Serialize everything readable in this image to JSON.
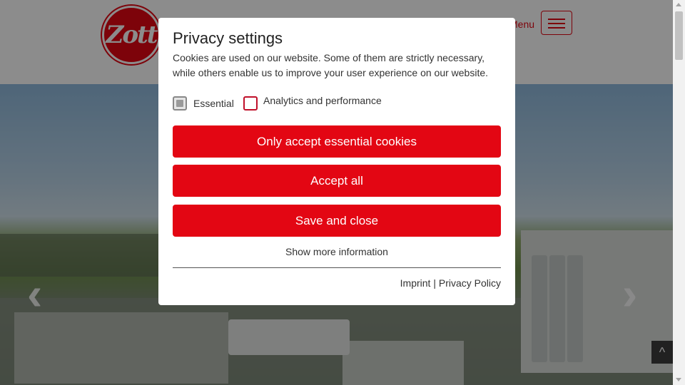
{
  "header": {
    "logo_text": "Zott",
    "menu_label": "Menu"
  },
  "hero": {
    "prev_arrow": "‹",
    "next_arrow": "›"
  },
  "back_to_top_icon": "^",
  "privacy_dialog": {
    "title": "Privacy settings",
    "description": "Cookies are used on our website. Some of them are strictly necessary, while others enable us to improve your user experience on our website.",
    "checkboxes": [
      {
        "label": "Essential",
        "checked": true,
        "disabled": true
      },
      {
        "label": "Analytics and performance",
        "checked": false,
        "disabled": false
      }
    ],
    "buttons": {
      "essential": "Only accept essential cookies",
      "accept_all": "Accept all",
      "save_close": "Save and close"
    },
    "more_info": "Show more information",
    "footer": {
      "imprint": "Imprint",
      "separator": "|",
      "privacy_policy": "Privacy Policy"
    }
  },
  "colors": {
    "brand_red": "#e30613",
    "overlay": "rgba(0,0,0,0.45)"
  }
}
